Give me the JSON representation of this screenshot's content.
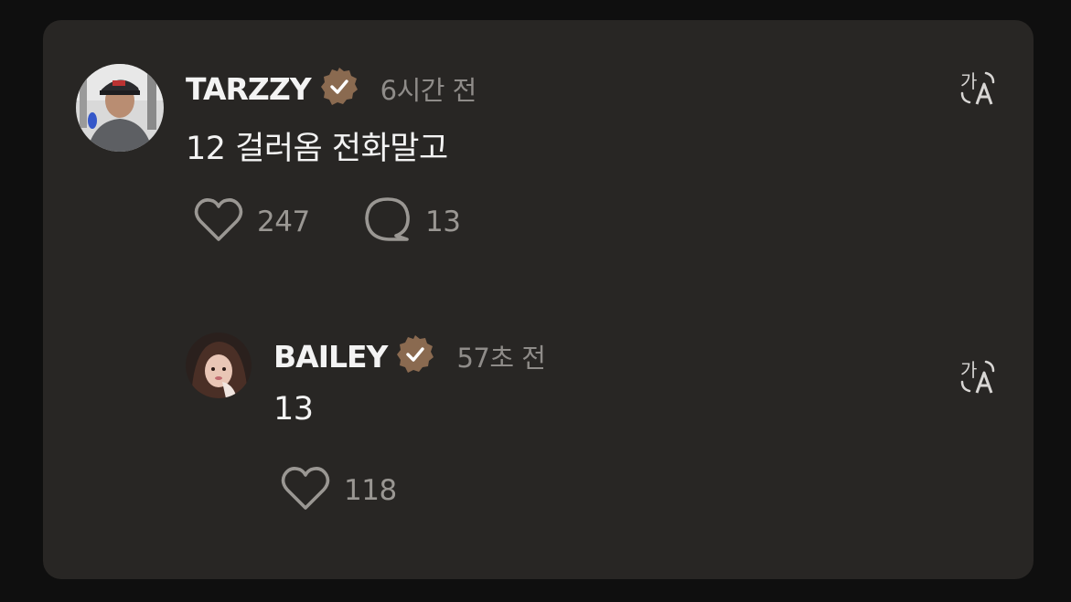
{
  "comments": [
    {
      "username": "TARZZY",
      "verified": true,
      "time": "6시간 전",
      "text": "12 걸러옴 전화말고",
      "likes": "247",
      "replies": "13"
    },
    {
      "username": "BAILEY",
      "verified": true,
      "time": "57초 전",
      "text": "13",
      "likes": "118"
    }
  ],
  "colors": {
    "card_bg": "#282624",
    "badge": "#8a6a50",
    "text": "#f3f3f3",
    "muted": "#8f8c89"
  },
  "icons": [
    "heart-icon",
    "comment-bubble-icon",
    "verified-badge-icon",
    "translate-icon"
  ]
}
